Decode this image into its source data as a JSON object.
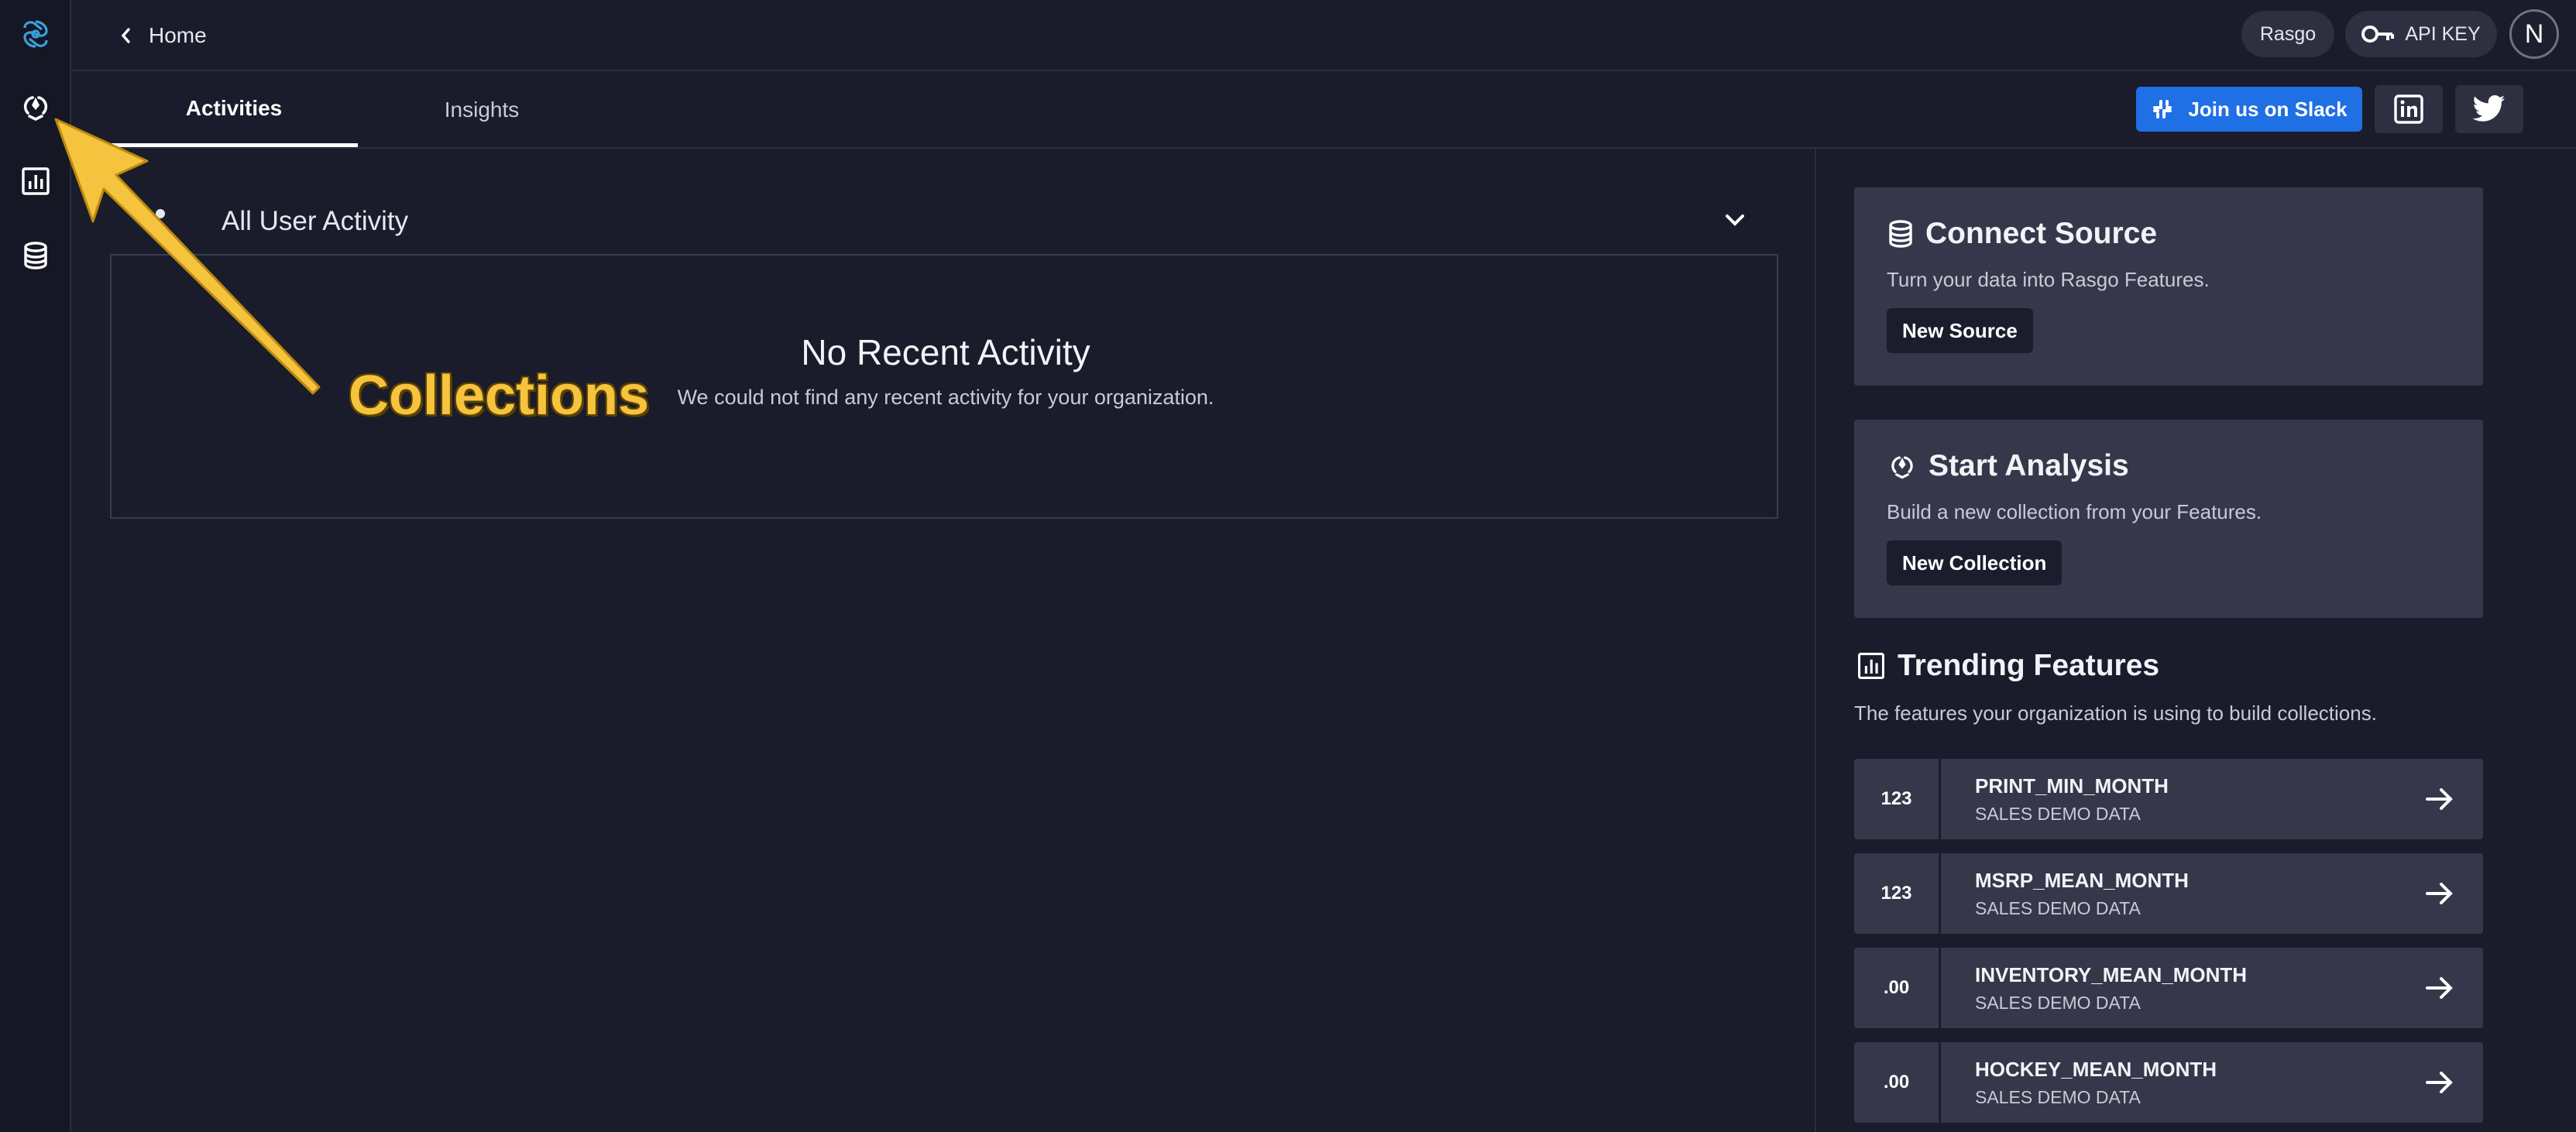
{
  "rail": {
    "icons": [
      "logo-icon",
      "collections-icon",
      "insights-icon",
      "database-icon"
    ]
  },
  "topbar": {
    "home_label": "Home",
    "org_chip": "Rasgo",
    "api_key_label": "API KEY",
    "avatar_initial": "N"
  },
  "tabs": [
    {
      "label": "Activities",
      "active": true
    },
    {
      "label": "Insights",
      "active": false
    }
  ],
  "social": {
    "slack_label": "Join us on Slack",
    "slack_color": "#1f6fe5"
  },
  "activity": {
    "header": "All User Activity",
    "empty_title": "No Recent Activity",
    "empty_description": "We could not find any recent activity for your organization."
  },
  "cards": {
    "connect": {
      "title": "Connect Source",
      "description": "Turn your data into Rasgo Features.",
      "button": "New Source"
    },
    "analysis": {
      "title": "Start Analysis",
      "description": "Build a new collection from your Features.",
      "button": "New Collection"
    }
  },
  "trending": {
    "title": "Trending Features",
    "description": "The features your organization is using to build collections.",
    "items": [
      {
        "type": "123",
        "name": "PRINT_MIN_MONTH",
        "source": "SALES DEMO DATA"
      },
      {
        "type": "123",
        "name": "MSRP_MEAN_MONTH",
        "source": "SALES DEMO DATA"
      },
      {
        "type": ".00",
        "name": "INVENTORY_MEAN_MONTH",
        "source": "SALES DEMO DATA"
      },
      {
        "type": ".00",
        "name": "HOCKEY_MEAN_MONTH",
        "source": "SALES DEMO DATA"
      }
    ]
  },
  "annotation": {
    "label": "Collections",
    "color": "#f6c33e"
  }
}
